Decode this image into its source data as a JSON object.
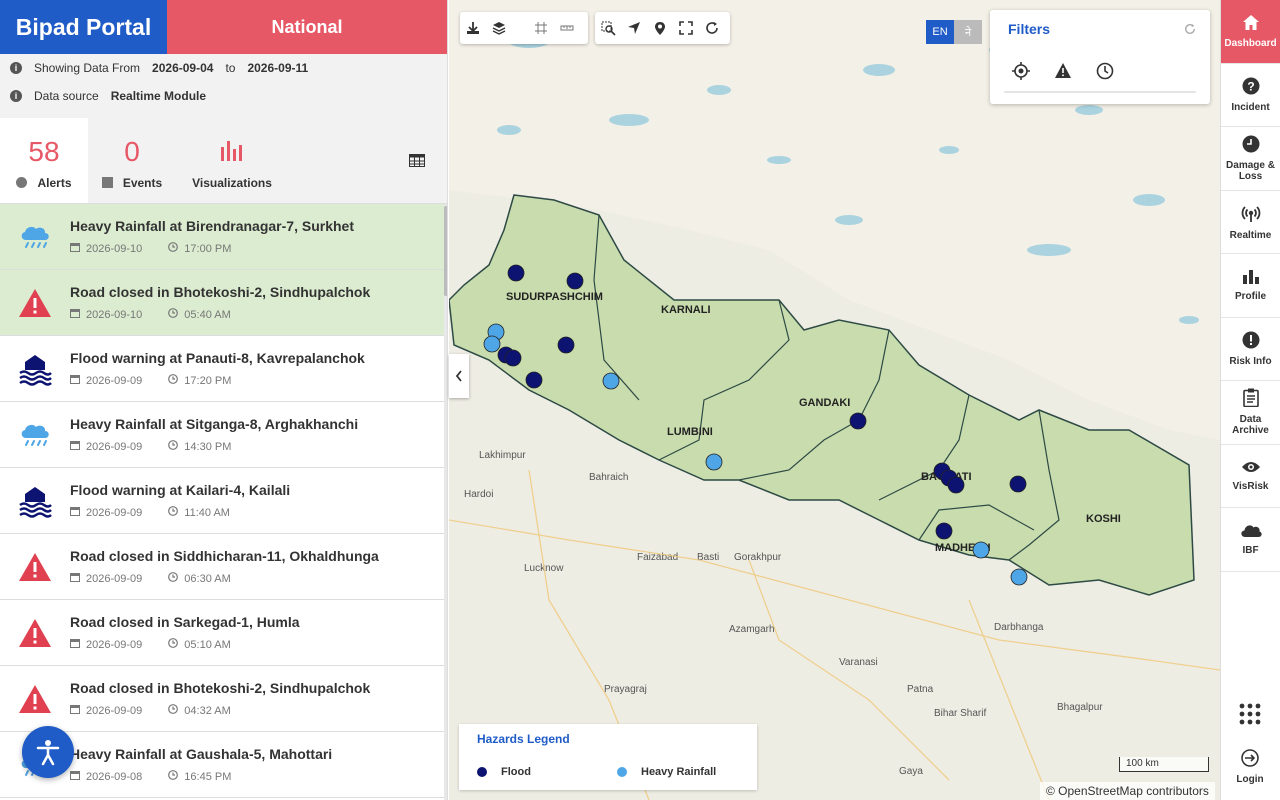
{
  "header": {
    "brand": "Bipad Portal",
    "region": "National"
  },
  "info": {
    "showing_label": "Showing Data From",
    "from_date": "2026-09-04",
    "to_label": "to",
    "to_date": "2026-09-11",
    "source_label": "Data source",
    "source_value": "Realtime Module"
  },
  "stats": {
    "alerts_count": "58",
    "alerts_label": "Alerts",
    "events_count": "0",
    "events_label": "Events",
    "viz_label": "Visualizations"
  },
  "alerts": [
    {
      "title": "Heavy Rainfall at Birendranagar-7, Surkhet",
      "date": "2026-09-10",
      "time": "17:00 PM",
      "icon": "rain-cloud-icon"
    },
    {
      "title": "Road closed in Bhotekoshi-2, Sindhupalchok",
      "date": "2026-09-10",
      "time": "05:40 AM",
      "icon": "warning-triangle-icon"
    },
    {
      "title": "Flood warning at Panauti-8, Kavrepalanchok",
      "date": "2026-09-09",
      "time": "17:20 PM",
      "icon": "flood-icon"
    },
    {
      "title": "Heavy Rainfall at Sitganga-8, Arghakhanchi",
      "date": "2026-09-09",
      "time": "14:30 PM",
      "icon": "rain-cloud-icon"
    },
    {
      "title": "Flood warning at Kailari-4, Kailali",
      "date": "2026-09-09",
      "time": "11:40 AM",
      "icon": "flood-icon"
    },
    {
      "title": "Road closed in Siddhicharan-11, Okhaldhunga",
      "date": "2026-09-09",
      "time": "06:30 AM",
      "icon": "warning-triangle-icon"
    },
    {
      "title": "Road closed in Sarkegad-1, Humla",
      "date": "2026-09-09",
      "time": "05:10 AM",
      "icon": "warning-triangle-icon"
    },
    {
      "title": "Road closed in Bhotekoshi-2, Sindhupalchok",
      "date": "2026-09-09",
      "time": "04:32 AM",
      "icon": "warning-triangle-icon"
    },
    {
      "title": "Heavy Rainfall at Gaushala-5, Mahottari",
      "date": "2026-09-08",
      "time": "16:45 PM",
      "icon": "rain-cloud-icon"
    }
  ],
  "map": {
    "language": {
      "en": "EN",
      "ne": "ने"
    },
    "filters_title": "Filters",
    "provinces": [
      "SUDURPASHCHIM",
      "KARNALI",
      "GANDAKI",
      "LUMBINI",
      "BAGMATI",
      "MADHESH",
      "KOSHI"
    ],
    "cities": [
      "Lakhimpur",
      "Bahraich",
      "Hardoi",
      "Faizabad",
      "Basti",
      "Gorakhpur",
      "Lucknow",
      "Azamgarh",
      "Varanasi",
      "Prayagraj",
      "Patna",
      "Darbhanga",
      "Bhagalpur",
      "Gaya",
      "Bihar Sharif"
    ],
    "legend_title": "Hazards Legend",
    "legend_items": [
      {
        "label": "Flood",
        "color": "#0d1370"
      },
      {
        "label": "Heavy Rainfall",
        "color": "#4fa6e6"
      }
    ],
    "scale": "100 km",
    "attribution": "© OpenStreetMap contributors"
  },
  "nav": [
    {
      "label": "Dashboard",
      "icon": "home-icon",
      "active": true
    },
    {
      "label": "Incident",
      "icon": "question-icon"
    },
    {
      "label": "Damage & Loss",
      "icon": "clock-icon"
    },
    {
      "label": "Realtime",
      "icon": "broadcast-icon"
    },
    {
      "label": "Profile",
      "icon": "bar-chart-icon"
    },
    {
      "label": "Risk Info",
      "icon": "exclamation-icon"
    },
    {
      "label": "Data Archive",
      "icon": "clipboard-icon"
    },
    {
      "label": "VisRisk",
      "icon": "eye-icon"
    },
    {
      "label": "IBF",
      "icon": "cloud-icon"
    }
  ],
  "nav_login": "Login"
}
